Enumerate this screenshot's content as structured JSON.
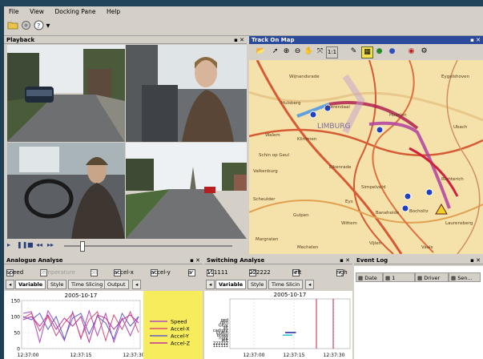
{
  "menu": [
    "File",
    "View",
    "Docking Pane",
    "Help"
  ],
  "toolbar": {
    "icons": [
      "open-folder-icon",
      "record-icon",
      "help-icon"
    ],
    "dropdown": "▾"
  },
  "playback": {
    "title": "Playback",
    "controls_glyph": "▪ ✕",
    "player_icons": [
      "play-icon",
      "pause-icon",
      "stop-icon",
      "rewind-icon",
      "fast-forward-icon"
    ]
  },
  "map": {
    "title": "Track On Map",
    "controls_glyph": "▪ ✕",
    "labels": [
      "Wijnandsrade",
      "Hulsberg",
      "Voerendaal",
      "Walem",
      "Klimmen",
      "LIMBURG",
      "Schin op Geul",
      "Valkenburg",
      "Heerlen",
      "Eikenrade",
      "Simpelveld",
      "Bocholtz",
      "Eys",
      "Scheulder",
      "Gulpen",
      "Wittem",
      "Baneheide",
      "Vijlen",
      "Richterich",
      "Eygelshoven",
      "Laurensberg",
      "Margraten",
      "Mechelen",
      "Vaals",
      "Ubach"
    ]
  },
  "analogue": {
    "title": "Analogue Analyse",
    "controls_glyph": "▪ ✕",
    "checks": [
      {
        "label": "speed",
        "checked": true
      },
      {
        "label": "temperature",
        "checked": false
      },
      {
        "label": "oil",
        "checked": false
      },
      {
        "label": "accel-x",
        "checked": true
      },
      {
        "label": "accel-y",
        "checked": true
      },
      {
        "label": "a",
        "checked": true
      }
    ],
    "tabs": [
      "Variable",
      "Style",
      "Time Slicing",
      "Output"
    ],
    "tab_arrow": "◂"
  },
  "switching": {
    "title": "Switching Analyse",
    "controls_glyph": "▪ ✕",
    "checks": [
      {
        "label": "111111",
        "checked": true
      },
      {
        "label": "222222",
        "checked": true
      },
      {
        "label": "left",
        "checked": true
      },
      {
        "label": "righ",
        "checked": true
      }
    ],
    "tabs": [
      "Variable",
      "Style",
      "Time Slicin"
    ],
    "tab_arrow": "◂"
  },
  "event_log": {
    "title": "Event Log",
    "controls_glyph": "▪ ✕",
    "columns": [
      "Date",
      "1",
      "Driver",
      "Sen..."
    ]
  },
  "chart_data": [
    {
      "type": "line",
      "title": "2005-10-17",
      "x": [
        "12:37:00",
        "12:37:15",
        "12:37:30"
      ],
      "yticks": [
        0,
        50,
        100,
        150
      ],
      "ylim": [
        0,
        150
      ],
      "legend_position": "right",
      "series": [
        {
          "name": "Speed",
          "color": "#b04cc0",
          "values": [
            110,
            115,
            20,
            118,
            75,
            25,
            115,
            30,
            118,
            40,
            110,
            20,
            95,
            40,
            100
          ]
        },
        {
          "name": "Accel-X",
          "color": "#d8507a",
          "values": [
            95,
            110,
            55,
            100,
            40,
            80,
            110,
            35,
            90,
            115,
            25,
            105,
            60,
            115,
            50
          ]
        },
        {
          "name": "Accel-Y",
          "color": "#6060c8",
          "values": [
            100,
            90,
            110,
            60,
            100,
            30,
            95,
            110,
            45,
            100,
            80,
            30,
            110,
            70,
            100
          ]
        },
        {
          "name": "Accel-Z",
          "color": "#c030a0",
          "values": [
            90,
            100,
            70,
            105,
            60,
            95,
            70,
            100,
            20,
            105,
            95,
            60,
            90,
            105,
            80
          ]
        }
      ],
      "colors": {
        "legend_bg": "#f6ec5c",
        "plot_bg": "#ffffff"
      }
    },
    {
      "type": "scatter",
      "title": "2005-10-17",
      "x": [
        "12:37:00",
        "12:37:15",
        "12:37:30"
      ],
      "yticks": [
        "111111",
        "222222",
        "left",
        "right",
        "brake",
        "clutch",
        "carlight",
        "alt",
        "Gear",
        "rpm",
        "qed"
      ],
      "series": [
        {
          "name": "222222",
          "color": "#1c1c9c",
          "values": [
            {
              "x": 0.46,
              "y": 5
            },
            {
              "x": 0.55,
              "y": 5
            }
          ]
        },
        {
          "name": "111111",
          "color": "#2cc0d0",
          "values": [
            {
              "x": 0.44,
              "y": 4
            },
            {
              "x": 0.52,
              "y": 4
            }
          ]
        }
      ],
      "markers": [
        {
          "x": 0.72,
          "color": "#d02040"
        },
        {
          "x": 0.86,
          "color": "#d02040"
        }
      ]
    }
  ]
}
